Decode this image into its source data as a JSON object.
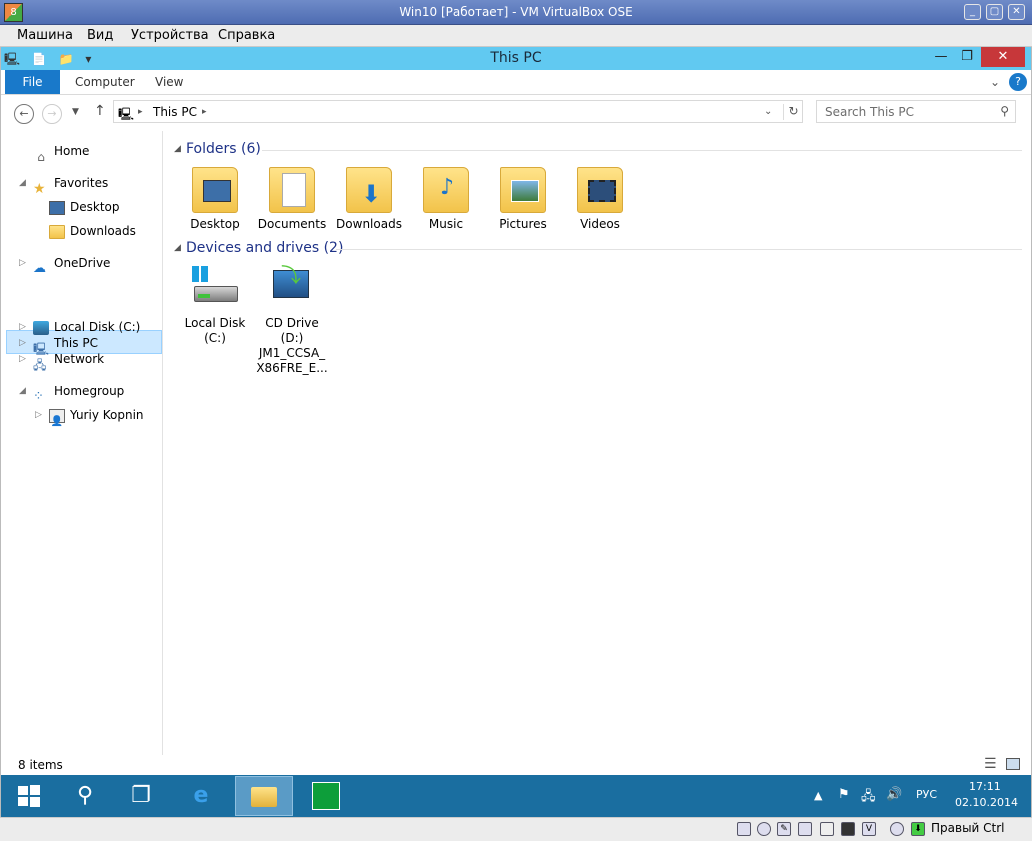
{
  "vbox": {
    "title": "Win10 [Работает] - VM VirtualBox OSE",
    "icon_glyph": "8",
    "menu": [
      "Машина",
      "Вид",
      "Устройства",
      "Справка"
    ],
    "host_key": "Правый Ctrl"
  },
  "explorer": {
    "title": "This PC",
    "ribbon_tabs": [
      "File",
      "Computer",
      "View"
    ],
    "address_crumb": "This PC",
    "search_placeholder": "Search This PC",
    "nav": {
      "home": "Home",
      "favorites": "Favorites",
      "desktop": "Desktop",
      "downloads": "Downloads",
      "onedrive": "OneDrive",
      "this_pc": "This PC",
      "local_disk": "Local Disk (C:)",
      "network": "Network",
      "homegroup": "Homegroup",
      "user": "Yuriy Kopnin"
    },
    "folders_header": "Folders (6)",
    "folders": [
      "Desktop",
      "Documents",
      "Downloads",
      "Music",
      "Pictures",
      "Videos"
    ],
    "devices_header": "Devices and drives (2)",
    "drives": [
      {
        "line1": "Local Disk",
        "line2": "(C:)"
      },
      {
        "line1": "CD Drive",
        "line2": "(D:)",
        "line3": "JM1_CCSA_",
        "line4": "X86FRE_E..."
      }
    ],
    "status": "8 items"
  },
  "taskbar": {
    "language": "РУС",
    "time": "17:11",
    "date": "02.10.2014"
  },
  "colors": {
    "titlebar": "#61c9f1",
    "file_tab": "#1979ca",
    "taskbar": "#1a6ea0",
    "close": "#c7373a",
    "group_header": "#1e3287"
  }
}
